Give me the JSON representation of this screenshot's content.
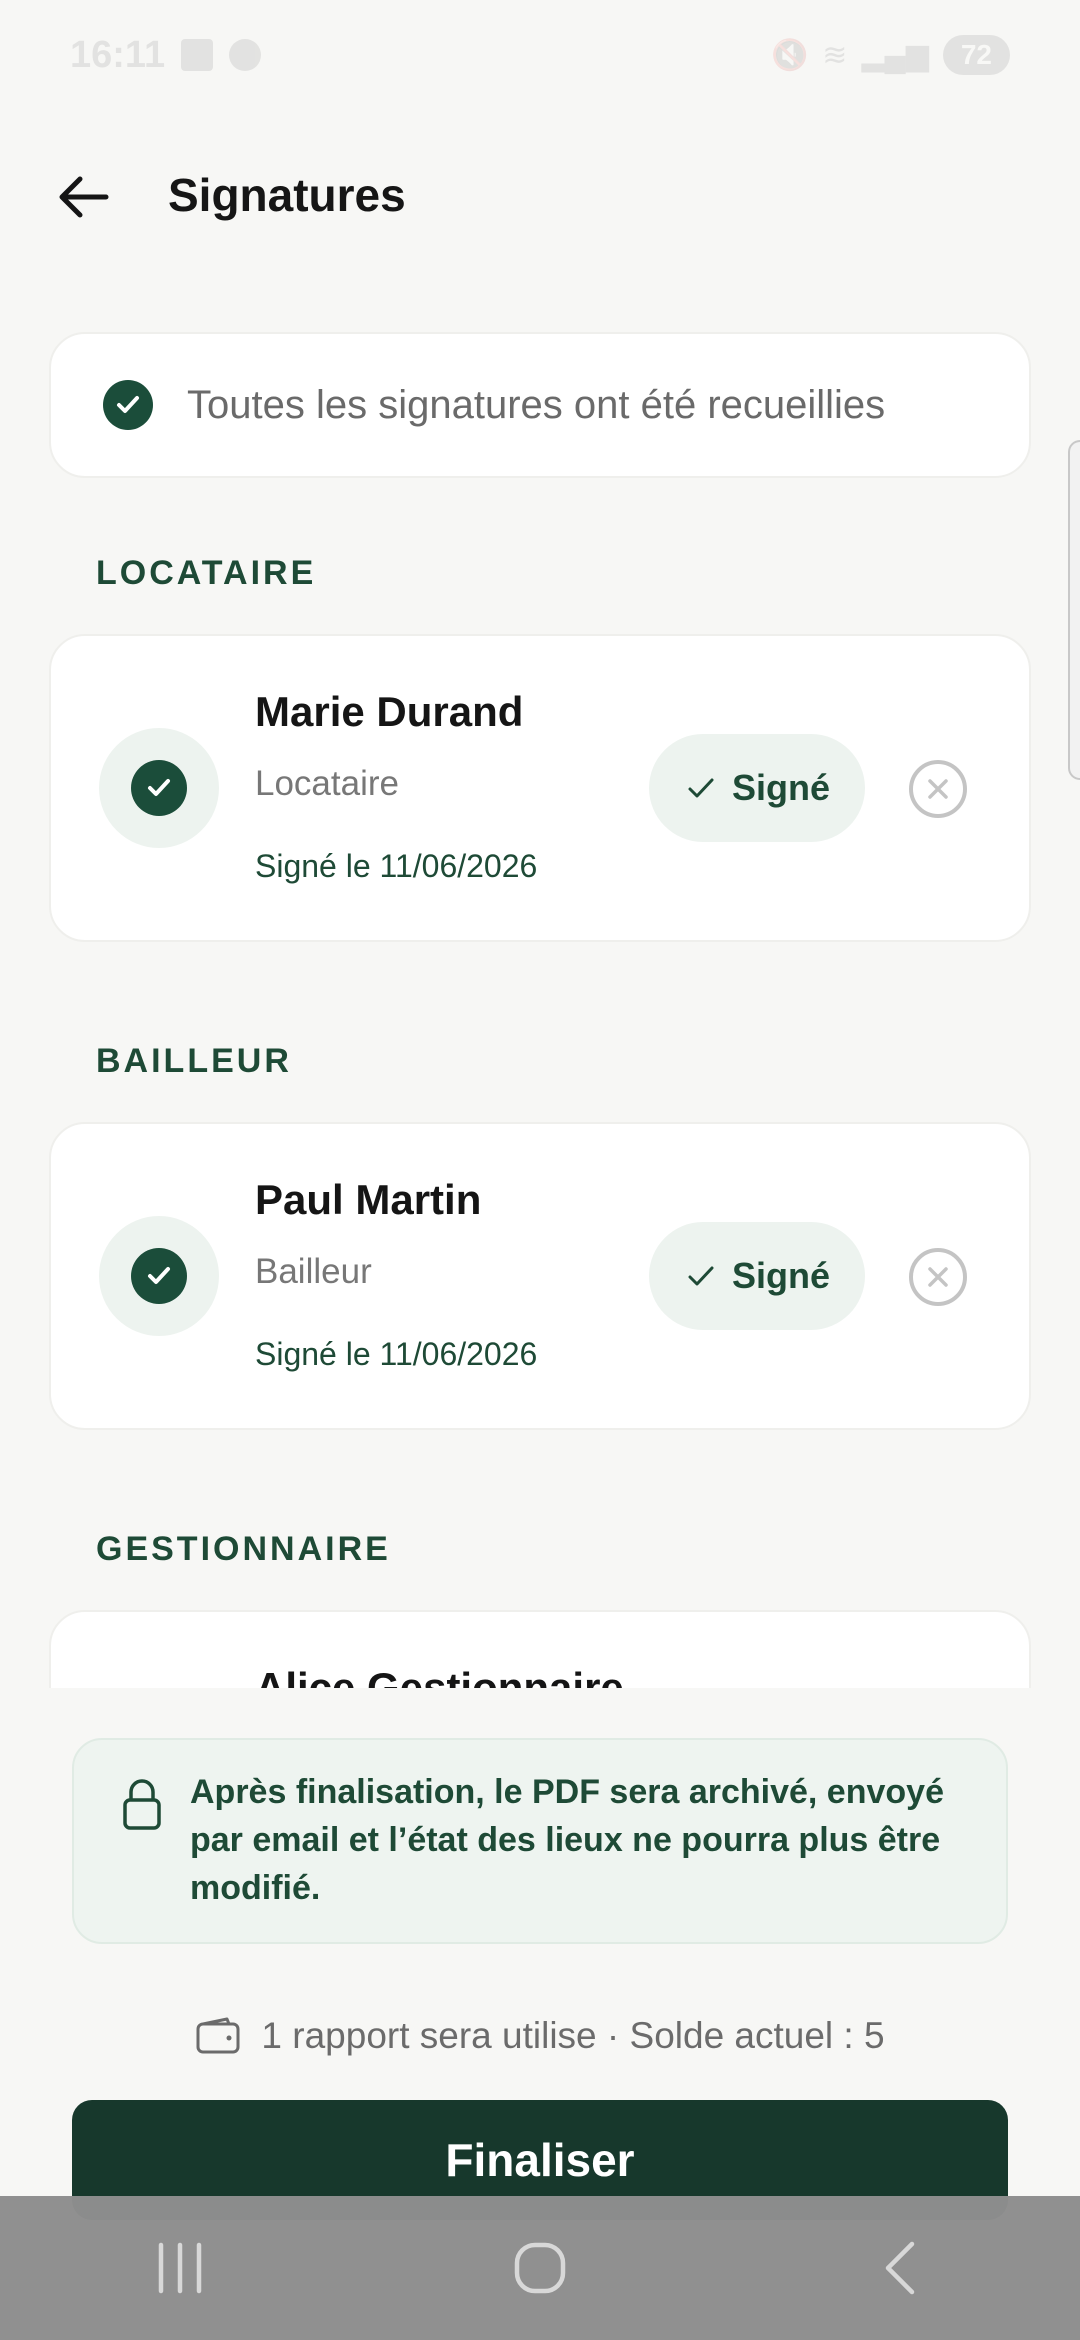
{
  "status_bar": {
    "time": "16:11",
    "battery": "72"
  },
  "header": {
    "title": "Signatures",
    "back_icon": "arrow-left-icon"
  },
  "banner": {
    "text": "Toutes les signatures ont été recueillies"
  },
  "sections": [
    {
      "label": "LOCATAIRE",
      "signer": {
        "name": "Marie Durand",
        "role": "Locataire",
        "date": "Signé le 11/06/2026",
        "status": "Signé"
      }
    },
    {
      "label": "BAILLEUR",
      "signer": {
        "name": "Paul Martin",
        "role": "Bailleur",
        "date": "Signé le 11/06/2026",
        "status": "Signé"
      }
    },
    {
      "label": "GESTIONNAIRE",
      "signer": {
        "name": "Alice Gestionnaire"
      }
    }
  ],
  "footer": {
    "info_text": "Après finalisation, le PDF sera archivé, envoyé par email et l’état des lieux ne pourra plus être modifié.",
    "credits_text": "1 rapport sera utilise · Solde actuel : 5",
    "finalize_label": "Finaliser"
  },
  "colors": {
    "accent": "#1b4d3a",
    "button": "#17382c",
    "pill_bg": "#edf3ef"
  }
}
